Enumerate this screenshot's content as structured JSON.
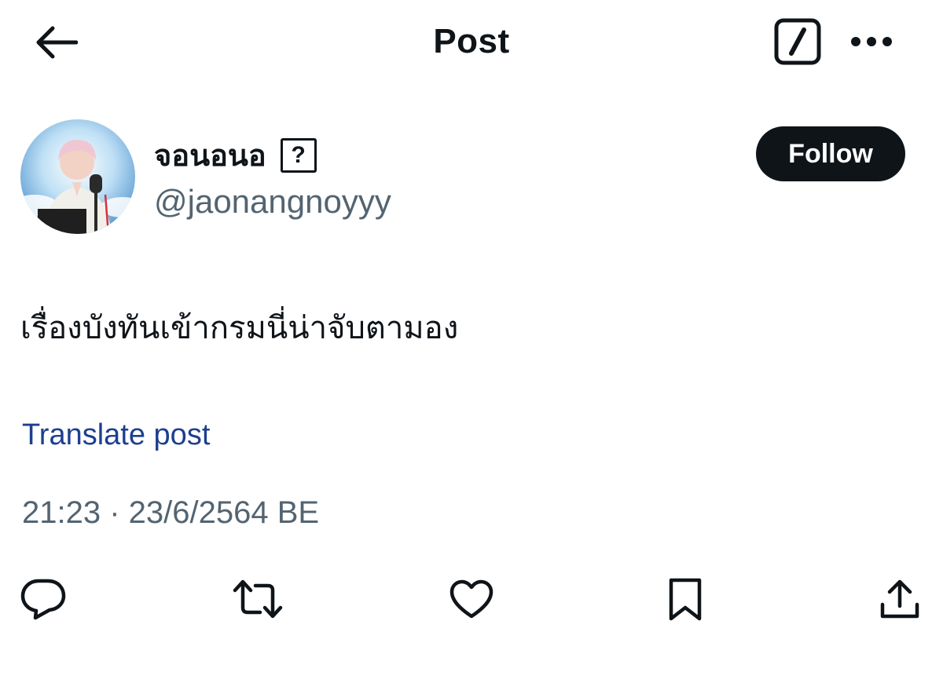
{
  "header": {
    "title": "Post",
    "back_icon": "arrow-left-icon",
    "compose_icon": "compose-icon",
    "more_icon": "more-horizontal-icon"
  },
  "author": {
    "display_name": "จอนอนอ",
    "unknown_char": "?",
    "handle": "@jaonangnoyyy",
    "avatar": "avatar-photo"
  },
  "follow_button": {
    "label": "Follow"
  },
  "post": {
    "text": "เรื่องบังทันเข้ากรมนี่น่าจับตามอง",
    "translate_label": "Translate post",
    "timestamp": "21:23 · 23/6/2564 BE"
  },
  "actions": [
    {
      "name": "reply",
      "icon": "reply-icon"
    },
    {
      "name": "repost",
      "icon": "repost-icon"
    },
    {
      "name": "like",
      "icon": "heart-icon"
    },
    {
      "name": "bookmark",
      "icon": "bookmark-icon"
    },
    {
      "name": "share",
      "icon": "share-icon"
    }
  ],
  "colors": {
    "text": "#0f1419",
    "secondary": "#536471",
    "link": "#1d3f8f",
    "follow_bg": "#0f1419"
  }
}
